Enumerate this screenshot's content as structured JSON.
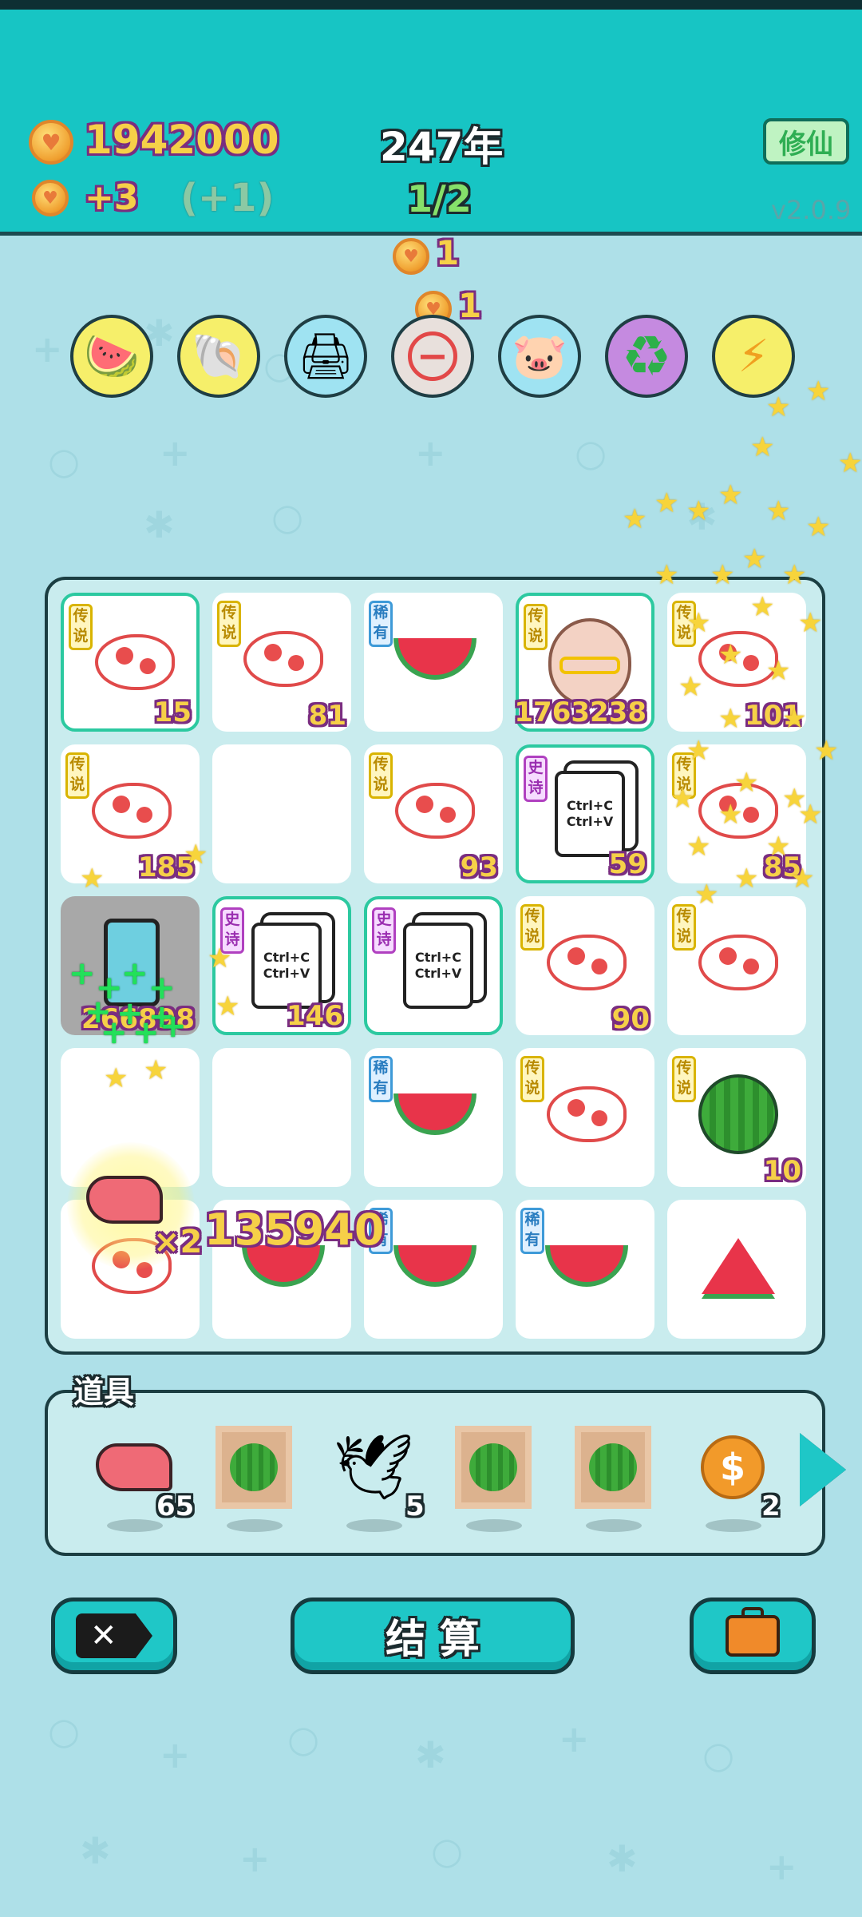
{
  "header": {
    "gold_total": "1942000",
    "income": "+3",
    "income_bonus": "(+1)",
    "year": "247年",
    "progress": "1/2",
    "mode_button": "修仙",
    "version": "v2.0.9"
  },
  "popups": [
    "1",
    "1"
  ],
  "relics": [
    {
      "icon": "fruit-basket-icon"
    },
    {
      "icon": "shell-icon"
    },
    {
      "icon": "printer-icon"
    },
    {
      "icon": "minus-coin-icon"
    },
    {
      "icon": "piggy-bank-icon"
    },
    {
      "icon": "recycle-icon"
    },
    {
      "icon": "lightning-icon"
    }
  ],
  "board": {
    "rows": [
      [
        {
          "tag": "传说",
          "kind": "fish",
          "num": "15",
          "hl": true
        },
        {
          "tag": "传说",
          "kind": "fish",
          "num": "81"
        },
        {
          "tag": "稀有",
          "kind": "watermelon",
          "num": ""
        },
        {
          "tag": "传说",
          "kind": "face",
          "num": "1763238",
          "hl": true
        },
        {
          "tag": "传说",
          "kind": "fish",
          "num": "101"
        }
      ],
      [
        {
          "tag": "传说",
          "kind": "fish",
          "num": "185"
        },
        {
          "tag": "",
          "kind": "empty",
          "num": ""
        },
        {
          "tag": "传说",
          "kind": "fish",
          "num": "93"
        },
        {
          "tag": "史诗",
          "kind": "ctrl-card",
          "num": "59",
          "hl": true
        },
        {
          "tag": "传说",
          "kind": "fish",
          "num": "85"
        }
      ],
      [
        {
          "tag": "",
          "kind": "phone",
          "num": "266898"
        },
        {
          "tag": "史诗",
          "kind": "ctrl-card",
          "num": "146",
          "hl": true
        },
        {
          "tag": "史诗",
          "kind": "ctrl-card",
          "num": "",
          "hl": true
        },
        {
          "tag": "传说",
          "kind": "fish",
          "num": "90"
        },
        {
          "tag": "传说",
          "kind": "fish",
          "num": ""
        }
      ],
      [
        {
          "tag": "",
          "kind": "empty",
          "num": ""
        },
        {
          "tag": "",
          "kind": "empty",
          "num": ""
        },
        {
          "tag": "稀有",
          "kind": "watermelon",
          "num": ""
        },
        {
          "tag": "传说",
          "kind": "fish",
          "num": ""
        },
        {
          "tag": "传说",
          "kind": "green-melon",
          "num": "10"
        }
      ],
      [
        {
          "tag": "",
          "kind": "fish",
          "num": ""
        },
        {
          "tag": "",
          "kind": "watermelon",
          "num": ""
        },
        {
          "tag": "稀有",
          "kind": "watermelon",
          "num": ""
        },
        {
          "tag": "稀有",
          "kind": "watermelon",
          "num": ""
        },
        {
          "tag": "",
          "kind": "melon-slice",
          "num": ""
        }
      ]
    ],
    "card_text": "Ctrl+C\nCtrl+V",
    "float_multiplier": "×2",
    "float_value": "135940"
  },
  "items": {
    "title": "道具",
    "list": [
      {
        "icon": "liver-icon",
        "count": "65"
      },
      {
        "icon": "framed-melon-icon",
        "count": ""
      },
      {
        "icon": "goose-icon",
        "count": "5"
      },
      {
        "icon": "framed-melon-icon",
        "count": ""
      },
      {
        "icon": "framed-melon-icon",
        "count": ""
      },
      {
        "icon": "dollar-coin-icon",
        "count": "2"
      }
    ]
  },
  "actions": {
    "settle_label": "结 算"
  },
  "colors": {
    "topbar": "#17c5c4",
    "background": "#aee0e8",
    "button": "#1fc7c7"
  }
}
